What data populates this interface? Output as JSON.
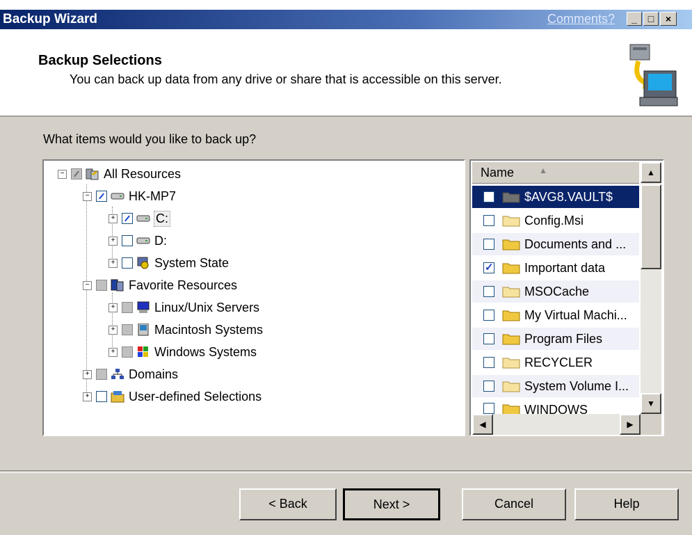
{
  "window": {
    "title": "Backup Wizard",
    "comments_link": "Comments?",
    "minimize": "_",
    "maximize": "□",
    "close": "×"
  },
  "header": {
    "title": "Backup Selections",
    "subtitle": "You can back up data from any drive or share that is accessible on this server."
  },
  "question": "What items would you like to back up?",
  "tree": {
    "items": [
      {
        "label": "All Resources",
        "expander": "−",
        "state": "gray-partial",
        "icon": "resources-icon"
      },
      {
        "label": "HK-MP7",
        "expander": "−",
        "state": "partial",
        "icon": "server-drive-icon"
      },
      {
        "label": "C:",
        "expander": "+",
        "state": "partial",
        "icon": "drive-icon"
      },
      {
        "label": "D:",
        "expander": "+",
        "state": "unchecked",
        "icon": "drive-icon"
      },
      {
        "label": "System State",
        "expander": "+",
        "state": "unchecked",
        "icon": "system-state-icon"
      },
      {
        "label": "Favorite Resources",
        "expander": "−",
        "state": "gray",
        "icon": "favorites-icon"
      },
      {
        "label": "Linux/Unix Servers",
        "expander": "+",
        "state": "gray",
        "icon": "monitor-icon"
      },
      {
        "label": "Macintosh Systems",
        "expander": "+",
        "state": "gray",
        "icon": "mac-icon"
      },
      {
        "label": "Windows Systems",
        "expander": "+",
        "state": "gray",
        "icon": "windows-icon"
      },
      {
        "label": "Domains",
        "expander": "+",
        "state": "gray",
        "icon": "domains-icon"
      },
      {
        "label": "User-defined Selections",
        "expander": "+",
        "state": "unchecked",
        "icon": "folder-icon"
      }
    ]
  },
  "list": {
    "column": "Name",
    "rows": [
      {
        "name": "$AVG8.VAULT$",
        "checked": false,
        "selected": true
      },
      {
        "name": "Config.Msi",
        "checked": false
      },
      {
        "name": "Documents and ...",
        "checked": false
      },
      {
        "name": "Important data",
        "checked": true
      },
      {
        "name": "MSOCache",
        "checked": false
      },
      {
        "name": "My Virtual Machi...",
        "checked": false
      },
      {
        "name": "Program Files",
        "checked": false
      },
      {
        "name": "RECYCLER",
        "checked": false
      },
      {
        "name": "System Volume I...",
        "checked": false
      },
      {
        "name": "WINDOWS",
        "checked": false
      }
    ]
  },
  "buttons": {
    "back": "< Back",
    "next": "Next >",
    "cancel": "Cancel",
    "help": "Help"
  }
}
